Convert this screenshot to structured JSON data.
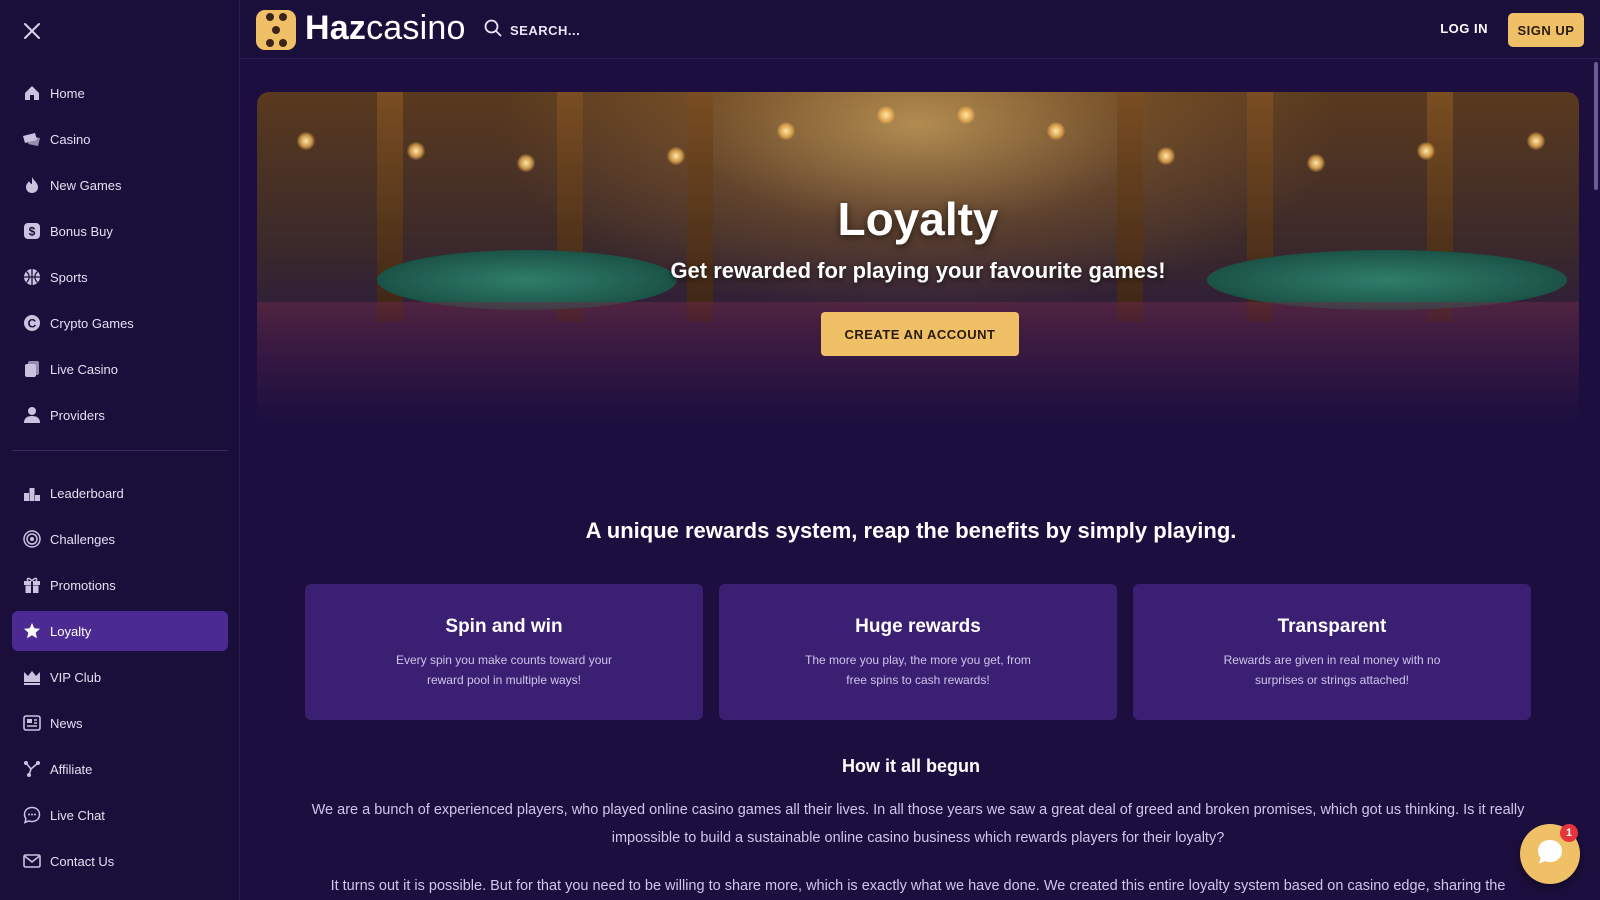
{
  "brand": {
    "name_bold": "Haz",
    "name_rest": "casino",
    "accent_color": "#f0c067",
    "background_color": "#1c0f3f",
    "active_nav_color": "#4c2a93"
  },
  "header": {
    "search_placeholder": "SEARCH...",
    "login_label": "LOG IN",
    "signup_label": "SIGN UP"
  },
  "sidebar": {
    "primary": [
      {
        "label": "Home",
        "icon": "home-icon"
      },
      {
        "label": "Casino",
        "icon": "casino-icon"
      },
      {
        "label": "New Games",
        "icon": "flame-icon"
      },
      {
        "label": "Bonus Buy",
        "icon": "bonus-buy-icon"
      },
      {
        "label": "Sports",
        "icon": "sports-icon"
      },
      {
        "label": "Crypto Games",
        "icon": "crypto-icon"
      },
      {
        "label": "Live Casino",
        "icon": "live-casino-icon"
      },
      {
        "label": "Providers",
        "icon": "providers-icon"
      }
    ],
    "secondary": [
      {
        "label": "Leaderboard",
        "icon": "leaderboard-icon"
      },
      {
        "label": "Challenges",
        "icon": "target-icon"
      },
      {
        "label": "Promotions",
        "icon": "gift-icon"
      },
      {
        "label": "Loyalty",
        "icon": "star-icon",
        "active": true
      },
      {
        "label": "VIP Club",
        "icon": "crown-icon"
      },
      {
        "label": "News",
        "icon": "news-icon"
      },
      {
        "label": "Affiliate",
        "icon": "affiliate-icon"
      },
      {
        "label": "Live Chat",
        "icon": "chat-bubble-icon"
      },
      {
        "label": "Contact Us",
        "icon": "mail-icon"
      }
    ]
  },
  "hero": {
    "title": "Loyalty",
    "subtitle": "Get rewarded for playing your favourite games!",
    "cta": "CREATE AN ACCOUNT"
  },
  "rewards": {
    "title": "A unique rewards system, reap the benefits by simply playing.",
    "cards": [
      {
        "title": "Spin and win",
        "desc": "Every spin you make counts toward your reward pool in multiple ways!"
      },
      {
        "title": "Huge rewards",
        "desc": "The more you play, the more you get, from free spins to cash rewards!"
      },
      {
        "title": "Transparent",
        "desc": "Rewards are given in real money with no surprises or strings attached!"
      }
    ]
  },
  "story": {
    "title": "How it all begun",
    "p1": "We are a bunch of experienced players, who played online casino games all their lives. In all those years we saw a great deal of greed and broken promises, which got us thinking. Is it really impossible to build a sustainable online casino business which rewards players for their loyalty?",
    "p2": "It turns out it is possible. But for that you need to be willing to share more, which is exactly what we have done. We created this entire loyalty system based on casino edge, sharing the"
  },
  "chat": {
    "badge_count": "1"
  }
}
